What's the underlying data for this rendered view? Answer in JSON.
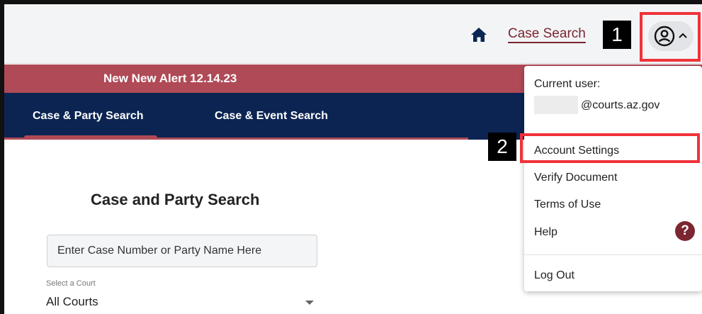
{
  "header": {
    "home_icon": "home-icon",
    "case_search_link": "Case Search",
    "user_icon": "user-circle-icon",
    "chevron_icon": "chevron-up-icon",
    "link_color": "#7b2631"
  },
  "callouts": [
    "1",
    "2"
  ],
  "alert": {
    "text": "New New Alert 12.14.23",
    "color": "#b04a56"
  },
  "nav": {
    "tabs": [
      {
        "label": "Case & Party Search",
        "active": true
      },
      {
        "label": "Case & Event Search",
        "active": false
      }
    ],
    "background": "#0b2452"
  },
  "main": {
    "title": "Case and Party Search",
    "search_placeholder": "Enter Case Number or Party Name Here",
    "court_label": "Select a Court",
    "court_value": "All Courts"
  },
  "user_menu": {
    "current_user_label": "Current user:",
    "email_suffix": "@courts.az.gov",
    "items": [
      "Account Settings",
      "Verify Document",
      "Terms of Use",
      "Help"
    ],
    "help_icon": "?",
    "logout": "Log Out"
  },
  "highlight_color": "#f0323a"
}
